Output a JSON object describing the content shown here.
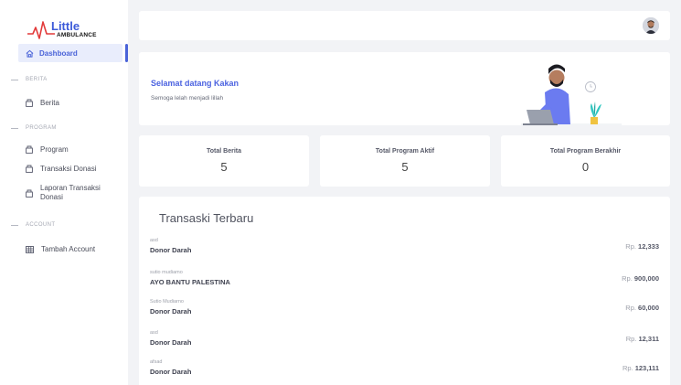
{
  "logo": {
    "brand": "Little",
    "sub": "AMBULANCE"
  },
  "sidebar": {
    "active": {
      "label": "Dashboard"
    },
    "sections": [
      {
        "title": "BERITA",
        "items": [
          {
            "label": "Berita"
          }
        ]
      },
      {
        "title": "PROGRAM",
        "items": [
          {
            "label": "Program"
          },
          {
            "label": "Transaksi Donasi"
          },
          {
            "label": "Laporan Transaksi Donasi"
          }
        ]
      },
      {
        "title": "ACCOUNT",
        "items": [
          {
            "label": "Tambah Account"
          }
        ]
      }
    ]
  },
  "welcome": {
    "title": "Selamat datang Kakan",
    "subtitle": "Semoga lelah menjadi lillah"
  },
  "stats": [
    {
      "label": "Total Berita",
      "value": "5"
    },
    {
      "label": "Total Program Aktif",
      "value": "5"
    },
    {
      "label": "Total Program Berakhir",
      "value": "0"
    }
  ],
  "transactions": {
    "title": "Transaski Terbaru",
    "currency": "Rp.",
    "rows": [
      {
        "user": "asd",
        "program": "Donor Darah",
        "amount": "12,333"
      },
      {
        "user": "sutio mudiamo",
        "program": "AYO BANTU PALESTINA",
        "amount": "900,000"
      },
      {
        "user": "Sutio Mudiarno",
        "program": "Donor Darah",
        "amount": "60,000"
      },
      {
        "user": "asd",
        "program": "Donor Darah",
        "amount": "12,311"
      },
      {
        "user": "afsad",
        "program": "Donor Darah",
        "amount": "123,111"
      }
    ]
  },
  "colors": {
    "accent": "#4a63d8",
    "background": "#f2f3f6"
  }
}
